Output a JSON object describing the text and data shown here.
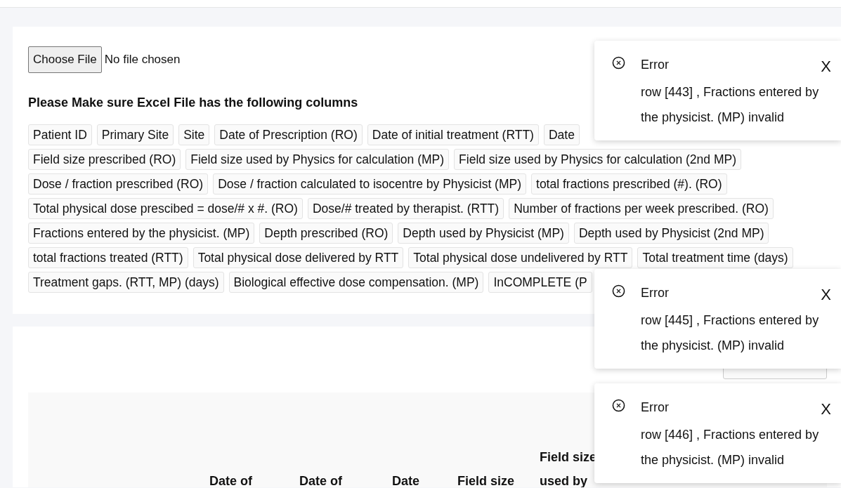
{
  "file_input": {
    "button": "Choose File",
    "status": "No file chosen"
  },
  "instructions": "Please Make sure Excel File has the following columns",
  "column_rows": [
    [
      "Patient ID",
      "Primary Site",
      "Site",
      "Date of Prescription (RO)",
      "Date of initial treatment (RTT)",
      "Date"
    ],
    [
      "Field size prescribed (RO)",
      "Field size used by Physics for calculation (MP)",
      "Field size used by Physics for calculation (2nd MP)"
    ],
    [
      "Dose / fraction prescribed (RO)",
      "Dose / fraction calculated to isocentre by Physicist (MP)",
      "total fractions prescribed (#). (RO)"
    ],
    [
      "Total physical dose prescibed = dose/# x #. (RO)",
      "Dose/# treated by therapist. (RTT)",
      "Number of fractions per week prescribed. (RO)"
    ],
    [
      "Fractions entered by the physicist. (MP)",
      "Depth prescribed (RO)",
      "Depth used by Physicist (MP)",
      "Depth used by Physicist (2nd MP)"
    ],
    [
      "total fractions treated (RTT)",
      "Total physical dose delivered by RTT",
      "Total physical dose undelivered by RTT",
      "Total treatment time (days)"
    ],
    [
      "Treatment gaps. (RTT, MP) (days)",
      "Biological effective dose compensation. (MP)",
      "InCOMPLETE (P"
    ]
  ],
  "table": {
    "columns": [
      {
        "lines": [
          "Date of"
        ]
      },
      {
        "lines": [
          "Date of"
        ]
      },
      {
        "lines": [
          "Date"
        ]
      },
      {
        "lines": [
          "Field size"
        ]
      },
      {
        "lines": [
          "Field size",
          "used by"
        ]
      }
    ]
  },
  "toasts": [
    {
      "title": "Error",
      "message": "row [443] , Fractions entered by the physicist. (MP) invalid",
      "close": "X"
    },
    {
      "title": "Error",
      "message": "row [445] , Fractions entered by the physicist. (MP) invalid",
      "close": "X"
    },
    {
      "title": "Error",
      "message": "row [446] , Fractions entered by the physicist. (MP) invalid",
      "close": "X"
    }
  ]
}
